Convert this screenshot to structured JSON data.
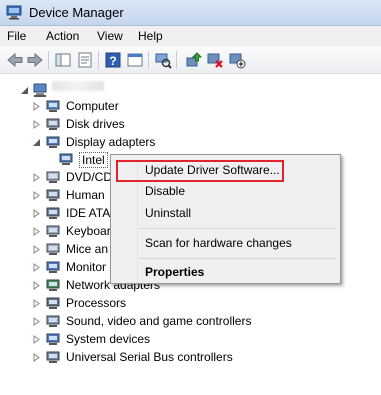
{
  "window": {
    "title": "Device Manager"
  },
  "menu": {
    "items": [
      "File",
      "Action",
      "View",
      "Help"
    ]
  },
  "toolbar": {
    "buttons": [
      "back-arrow-icon",
      "forward-arrow-icon",
      "show-hide-console-tree-icon",
      "properties-icon",
      "help-icon",
      "console-icon",
      "scan-hardware-icon",
      "update-driver-icon",
      "uninstall-icon",
      "disable-icon"
    ]
  },
  "tree": {
    "nodes": [
      {
        "label": "Computer",
        "icon": "computer-icon"
      },
      {
        "label": "Disk drives",
        "icon": "disk-drive-icon"
      },
      {
        "label": "Display adapters",
        "icon": "display-adapter-icon"
      },
      {
        "label": "Intel",
        "icon": "display-adapter-icon"
      },
      {
        "label": "DVD/CD",
        "icon": "dvd-icon"
      },
      {
        "label": "Human",
        "icon": "hid-icon"
      },
      {
        "label": "IDE ATA",
        "icon": "ide-icon"
      },
      {
        "label": "Keyboar",
        "icon": "keyboard-icon"
      },
      {
        "label": "Mice an",
        "icon": "mouse-icon"
      },
      {
        "label": "Monitor",
        "icon": "monitor-icon"
      },
      {
        "label": "Network adapters",
        "icon": "network-adapter-icon"
      },
      {
        "label": "Processors",
        "icon": "processor-icon"
      },
      {
        "label": "Sound, video and game controllers",
        "icon": "sound-icon"
      },
      {
        "label": "System devices",
        "icon": "system-devices-icon"
      },
      {
        "label": "Universal Serial Bus controllers",
        "icon": "usb-icon"
      }
    ]
  },
  "context_menu": {
    "items": [
      "Update Driver Software...",
      "Disable",
      "Uninstall",
      "Scan for hardware changes",
      "Properties"
    ],
    "highlight_color": "#e0262b"
  },
  "colors": {
    "titlebar": "#c4d6ee",
    "menubar": "#f0f0f0"
  }
}
